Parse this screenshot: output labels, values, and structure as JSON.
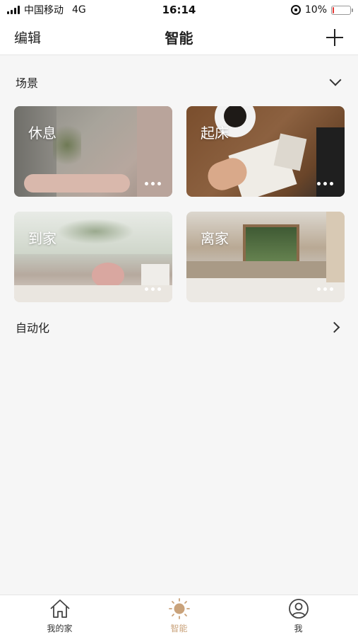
{
  "status_bar": {
    "carrier": "中国移动",
    "network": "4G",
    "time": "16:14",
    "battery": "10%",
    "battery_level": 0.1
  },
  "nav": {
    "left_label": "编辑",
    "title": "智能",
    "add_icon": "plus-icon"
  },
  "scenes": {
    "title": "场景",
    "toggle_icon": "chevron-down-icon",
    "items": [
      {
        "label": "休息",
        "more_icon": "more-dots-icon"
      },
      {
        "label": "起床",
        "more_icon": "more-dots-icon"
      },
      {
        "label": "到家",
        "more_icon": "more-dots-icon"
      },
      {
        "label": "离家",
        "more_icon": "more-dots-icon"
      }
    ]
  },
  "automation": {
    "title": "自动化",
    "arrow_icon": "chevron-right-icon"
  },
  "tab_bar": {
    "active_color": "#c9a27a",
    "tabs": [
      {
        "label": "我的家",
        "icon": "home-icon",
        "active": false
      },
      {
        "label": "智能",
        "icon": "sun-icon",
        "active": true
      },
      {
        "label": "我",
        "icon": "user-icon",
        "active": false
      }
    ]
  }
}
